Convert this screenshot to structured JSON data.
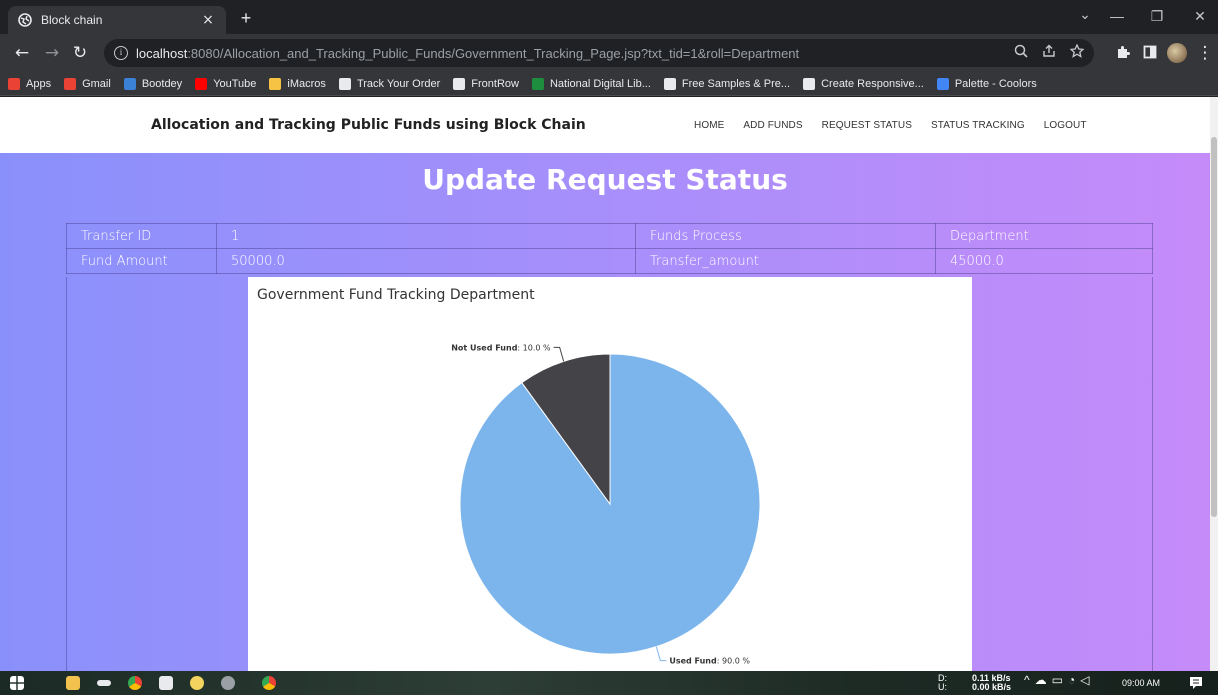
{
  "browser": {
    "tab": {
      "title": "Block chain",
      "close": "×"
    },
    "new_tab": "+",
    "window_controls": {
      "minimize": "—",
      "restore": "❐",
      "close": "✕",
      "tab_search": "⌄"
    },
    "url": {
      "host": "localhost",
      "rest": ":8080/Allocation_and_Tracking_Public_Funds/Government_Tracking_Page.jsp?txt_tid=1&roll=Department"
    },
    "bookmarks": [
      {
        "label": "Apps",
        "icon": "apps-grid-icon",
        "color": "#ea4335"
      },
      {
        "label": "Gmail",
        "icon": "gmail-icon",
        "color": "#ea4335"
      },
      {
        "label": "Bootdey",
        "icon": "bootdey-icon",
        "color": "#3b82d6"
      },
      {
        "label": "YouTube",
        "icon": "youtube-icon",
        "color": "#ff0000"
      },
      {
        "label": "iMacros",
        "icon": "folder-icon",
        "color": "#f6c344"
      },
      {
        "label": "Track Your Order",
        "icon": "track-order-icon",
        "color": "#e8eaed"
      },
      {
        "label": "FrontRow",
        "icon": "frontrow-icon",
        "color": "#e8eaed"
      },
      {
        "label": "National Digital Lib...",
        "icon": "globe-icon",
        "color": "#1e8e3e"
      },
      {
        "label": "Free Samples & Pre...",
        "icon": "free-samples-icon",
        "color": "#e8eaed"
      },
      {
        "label": "Create Responsive...",
        "icon": "create-responsive-icon",
        "color": "#e8eaed"
      },
      {
        "label": "Palette - Coolors",
        "icon": "palette-icon",
        "color": "#4285f4"
      }
    ]
  },
  "site": {
    "brand": "Allocation and Tracking Public Funds using Block Chain",
    "menu": [
      "HOME",
      "ADD FUNDS",
      "REQUEST STATUS",
      "STATUS TRACKING",
      "LOGOUT"
    ],
    "heading": "Update Request Status",
    "table": {
      "row1": {
        "label1": "Transfer ID",
        "value1": "1",
        "label2": "Funds Process",
        "value2": "Department"
      },
      "row2": {
        "label1": "Fund Amount",
        "value1": "50000.0",
        "label2": "Transfer_amount",
        "value2": "45000.0"
      }
    }
  },
  "chart_data": {
    "type": "pie",
    "title": "Government Fund Tracking Department",
    "slices": [
      {
        "name": "Used Fund",
        "value": 90.0,
        "label": "90.0 %",
        "color": "#7cb5ec"
      },
      {
        "name": "Not Used Fund",
        "value": 10.0,
        "label": "10.0 %",
        "color": "#434348"
      }
    ]
  },
  "taskbar": {
    "network": {
      "down_label": "D:",
      "down": "0.11 kB/s",
      "up_label": "U:",
      "up": "0.00 kB/s"
    },
    "clock": "09:00 AM"
  }
}
